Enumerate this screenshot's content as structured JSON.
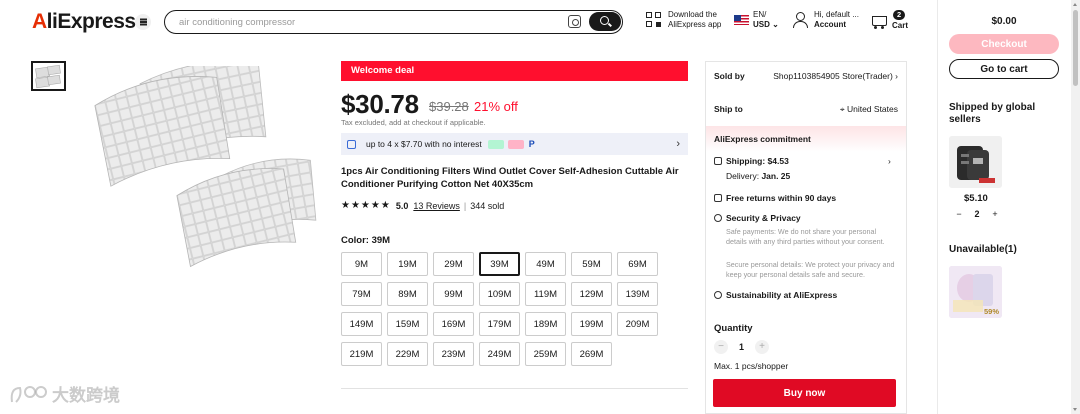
{
  "header": {
    "logo_text": "AliExpress",
    "search_placeholder": "air conditioning compressor",
    "download_line1": "Download the",
    "download_line2": "AliExpress app",
    "lang_line1": "EN/",
    "lang_line2": "USD",
    "account_line1": "Hi, default ...",
    "account_line2": "Account",
    "cart_count": "2",
    "cart_label": "Cart"
  },
  "product": {
    "welcome_deal": "Welcome deal",
    "price": "$30.78",
    "old_price": "$39.28",
    "discount": "21% off",
    "tax_note": "Tax excluded, add at checkout if applicable.",
    "installment": "up to 4 x $7.70 with no interest",
    "title": "1pcs Air Conditioning Filters Wind Outlet Cover Self-Adhesion Cuttable Air Conditioner Purifying Cotton Net 40X35cm",
    "stars": "★★★★★",
    "rating": "5.0",
    "reviews": "13 Reviews",
    "sold": "344 sold",
    "color_label": "Color: 39M",
    "variants": [
      "9M",
      "19M",
      "29M",
      "39M",
      "49M",
      "59M",
      "69M",
      "79M",
      "89M",
      "99M",
      "109M",
      "119M",
      "129M",
      "139M",
      "149M",
      "159M",
      "169M",
      "179M",
      "189M",
      "199M",
      "209M",
      "219M",
      "229M",
      "239M",
      "249M",
      "259M",
      "269M"
    ],
    "selected_variant": "39M"
  },
  "buybox": {
    "sold_by_label": "Sold by",
    "sold_by_value": "Shop1103854905 Store(Trader)",
    "ship_to_label": "Ship to",
    "ship_to_value": "United States",
    "commitment": "AliExpress commitment",
    "shipping": "Shipping: $4.53",
    "delivery_label": "Delivery:",
    "delivery_date": "Jan. 25",
    "returns": "Free returns within 90 days",
    "security_title": "Security & Privacy",
    "security_text1": "Safe payments: We do not share your personal details with any third parties without your consent.",
    "security_text2": "Secure personal details: We protect your privacy and keep your personal details safe and secure.",
    "sustainability": "Sustainability at AliExpress",
    "quantity_label": "Quantity",
    "quantity": "1",
    "max_note": "Max. 1 pcs/shopper",
    "buy_now": "Buy now"
  },
  "sidebar": {
    "total": "$0.00",
    "checkout": "Checkout",
    "go_to_cart": "Go to cart",
    "shipped_heading": "Shipped by global sellers",
    "item_price": "$5.10",
    "item_qty": "2",
    "unavailable_heading": "Unavailable(1)",
    "unavailable_badge": "59%"
  },
  "watermark": "大数跨境",
  "colors": {
    "accent_red": "#ff0f2e",
    "buy_red": "#e00a24",
    "checkout_pink": "#fdb8c0"
  }
}
